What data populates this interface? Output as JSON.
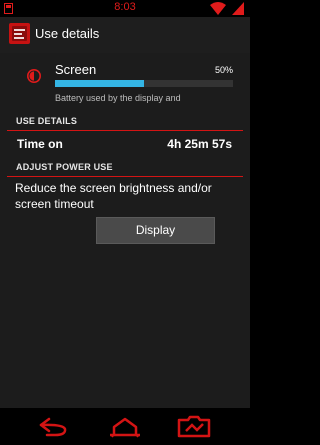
{
  "status_bar": {
    "time": "8:03",
    "icons": [
      "notification-icon",
      "wifi-icon",
      "battery-icon"
    ],
    "accent_color": "#e01b1b"
  },
  "action_bar": {
    "title": "Use details",
    "icon": "app-settings-icon",
    "accent_color": "#d31414"
  },
  "usage": {
    "item_label": "Screen",
    "percent_label": "50%",
    "percent": 50,
    "description": "Battery used by the display and",
    "icon": "brightness-icon",
    "bar_color": "#34b5e5"
  },
  "use_details": {
    "header": "USE DETAILS",
    "time_on_label": "Time on",
    "time_on_value": "4h 25m 57s"
  },
  "adjust_power": {
    "header": "ADJUST POWER USE",
    "description": "Reduce the screen brightness and/or screen timeout",
    "button_label": "Display"
  },
  "nav_bar": {
    "buttons": [
      "back-icon",
      "home-icon",
      "recents-icon"
    ]
  }
}
